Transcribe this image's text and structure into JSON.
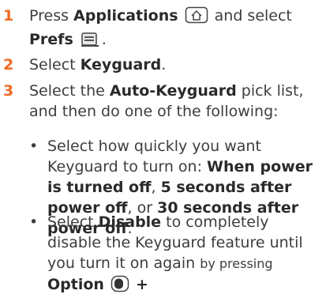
{
  "steps": [
    {
      "number": "1",
      "prefix": "Press ",
      "applications": "Applications",
      "middle": " and select",
      "prefs": "Prefs",
      "end": ".",
      "applications_icon": "applications-house-icon",
      "prefs_icon": "prefs-icon"
    },
    {
      "number": "2",
      "prefix": "Select ",
      "keyguard": "Keyguard",
      "end": "."
    },
    {
      "number": "3",
      "prefix": "Select the ",
      "auto_keyguard": "Auto-Keyguard",
      "suffix": " pick list, and then do one of the following:"
    }
  ],
  "bullets": [
    {
      "prefix": "Select how quickly you want Keyguard to turn on: ",
      "opt1": "When power is turned off",
      "sep1": ", ",
      "opt2": "5 seconds after power off",
      "sep2": ", or ",
      "opt3": "30 seconds after power off",
      "end": "."
    },
    {
      "prefix": "Select ",
      "disable": "Disable",
      "middle": " to completely disable the Keyguard feature until you turn it on again ",
      "by_pressing": "by pressing",
      "option": "Option",
      "option_icon": "option-key-icon",
      "plus": "+"
    }
  ],
  "colors": {
    "step_number": "#f26a21",
    "body_text": "#3d3d3d"
  }
}
